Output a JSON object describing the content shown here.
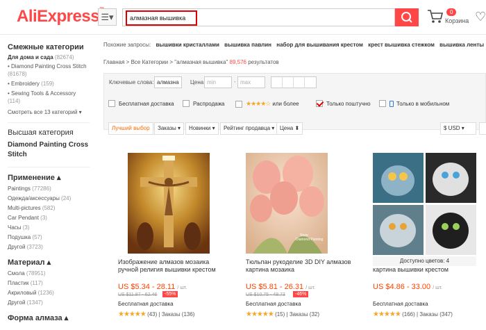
{
  "header": {
    "logo": "AliExpress",
    "logo_mark": "™",
    "search_value": "алмазная вышивка",
    "cart_count": "0",
    "cart_label": "Корзина"
  },
  "sidebar": {
    "related_title": "Смежные категории",
    "related": [
      {
        "label": "Для дома и сада",
        "count": "(82674)"
      },
      {
        "label": "Diamond Painting Cross Stitch",
        "count": "(81678)"
      },
      {
        "label": "Embroidery",
        "count": "(159)"
      },
      {
        "label": "Sewing Tools & Accessory",
        "count": "(114)"
      }
    ],
    "more": "Смотреть все 13 категорий",
    "top_title": "Высшая категория",
    "top_link": "Diamond Painting Cross Stitch",
    "apply_title": "Применение",
    "apply_items": [
      {
        "label": "Paintings",
        "count": "(77286)"
      },
      {
        "label": "Одежда/аксессуары",
        "count": "(24)"
      },
      {
        "label": "Multi-pictures",
        "count": "(582)"
      },
      {
        "label": "Car Pendant",
        "count": "(3)"
      },
      {
        "label": "Часы",
        "count": "(3)"
      },
      {
        "label": "Подушка",
        "count": "(57)"
      },
      {
        "label": "Другой",
        "count": "(3723)"
      }
    ],
    "material_title": "Материал",
    "material_items": [
      {
        "label": "Смола",
        "count": "(78951)"
      },
      {
        "label": "Пластик",
        "count": "(117)"
      },
      {
        "label": "Акриловый",
        "count": "(1236)"
      },
      {
        "label": "Другой",
        "count": "(1347)"
      }
    ],
    "shape_title": "Форма алмаза"
  },
  "main": {
    "related_label": "Похожие запросы:",
    "related_queries": [
      "вышивки кристаллами",
      "вышивка павлин",
      "набор для вышивания крестом",
      "крест вышивка стежком",
      "вышивка ленты"
    ],
    "breadcrumb_home": "Главная",
    "breadcrumb_all": "Все Категории",
    "breadcrumb_query": "\"алмазная вышивка\"",
    "result_count": "89,576",
    "result_label": "результатов",
    "filters": {
      "keywords_label": "Ключевые слова:",
      "keywords_value": "алмазна",
      "price_label": "Цена:",
      "price_min": "min",
      "price_max": "max",
      "free_ship": "Бесплатная доставка",
      "sale": "Распродажа",
      "or_more": "или более",
      "single": "Только поштучно",
      "mobile": "Только в мобильном",
      "sort_best": "Лучший выбор",
      "sort_orders": "Заказы",
      "sort_new": "Новинки",
      "sort_rating": "Рейтинг продавца",
      "sort_price": "Цена",
      "currency": "$ USD"
    },
    "products": [
      {
        "title": "Изображение алмазов мозаика ручной религия вышивки крестом",
        "price": "US $5.34 - 28.11",
        "unit": "/ шт.",
        "old": "US $11.87 - 62.46",
        "discount": "-55%",
        "shipping": "Бесплатная доставка",
        "reviews": "(43)",
        "orders": "Заказы (136)"
      },
      {
        "title": "Тюльпан рукоделие 3D DIY алмазов картина мозаика",
        "price": "US $5.81 - 26.31",
        "unit": "/ шт.",
        "old": "US $10.75 - 48.73",
        "discount": "-46%",
        "shipping": "Бесплатная доставка",
        "reviews": "(15)",
        "orders": "Заказы (32)"
      },
      {
        "title": "Красочные кошка алмазов мозаика картина вышивки крестом",
        "price": "US $4.86 - 33.00",
        "unit": "/ шт.",
        "colors": "Доступно цветов: 4",
        "shipping": "Бесплатная доставка",
        "reviews": "(166)",
        "orders": "Заказы (347)"
      }
    ]
  }
}
